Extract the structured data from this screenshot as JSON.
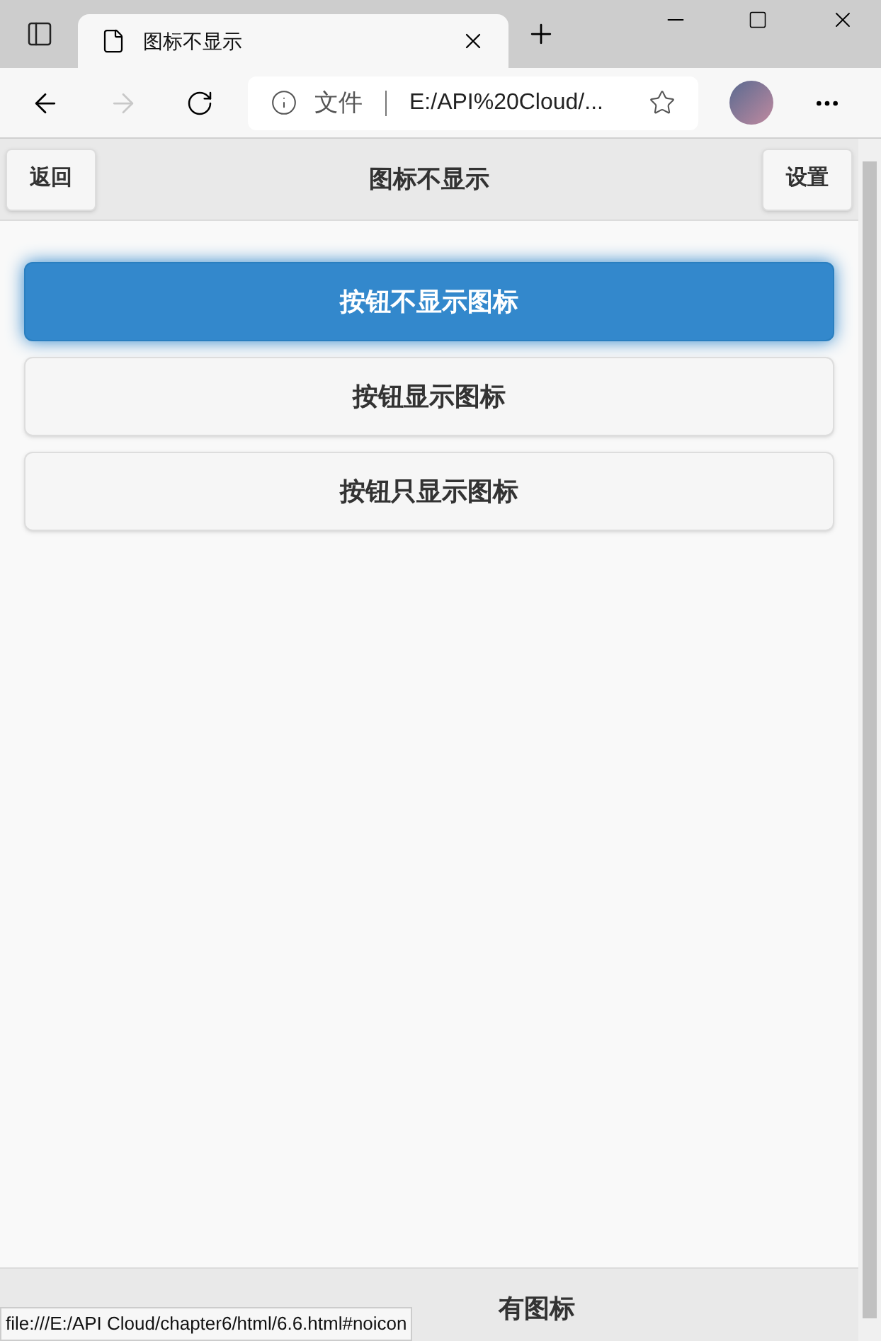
{
  "browser": {
    "tab_title": "图标不显示",
    "address_label": "文件",
    "address": "E:/API%20Cloud/..."
  },
  "header": {
    "back": "返回",
    "title": "图标不显示",
    "settings": "设置"
  },
  "buttons": [
    {
      "label": "按钮不显示图标",
      "selected": true
    },
    {
      "label": "按钮显示图标",
      "selected": false
    },
    {
      "label": "按钮只显示图标",
      "selected": false
    }
  ],
  "footer": {
    "title": "有图标"
  },
  "status_url": "file:///E:/API Cloud/chapter6/html/6.6.html#noicon"
}
